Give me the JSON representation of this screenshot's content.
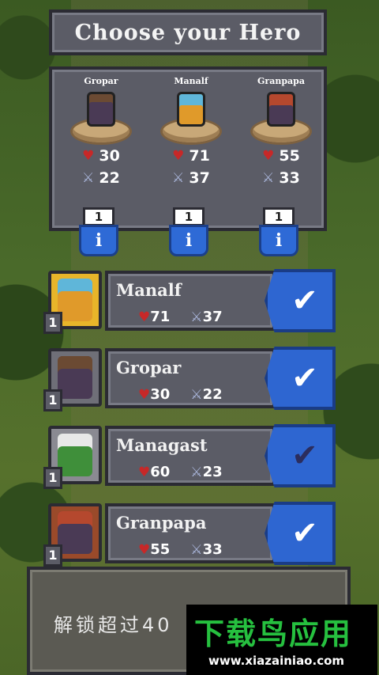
{
  "header": {
    "title": "Choose your Hero"
  },
  "selected_heroes": [
    {
      "name": "Gropar",
      "hp": "30",
      "atk": "22",
      "level": "1",
      "info_icon": "i",
      "color": "#4a3a55",
      "skin": "#6b4a33"
    },
    {
      "name": "Manalf",
      "hp": "71",
      "atk": "37",
      "level": "1",
      "info_icon": "i",
      "color": "#5fb6d9",
      "skin": "#f0c08a"
    },
    {
      "name": "Granpapa",
      "hp": "55",
      "atk": "33",
      "level": "1",
      "info_icon": "i",
      "color": "#b5482e",
      "skin": "#7a3a2a"
    }
  ],
  "hero_list": [
    {
      "name": "Manalf",
      "hp": "71",
      "atk": "37",
      "level": "1",
      "card_color": "#e8b52a",
      "sprite_color": "#5fb6d9",
      "checked": true,
      "check_color": "#ffffff"
    },
    {
      "name": "Gropar",
      "hp": "30",
      "atk": "22",
      "level": "1",
      "card_color": "#6f6f78",
      "sprite_color": "#4a3a55",
      "checked": true,
      "check_color": "#ffffff"
    },
    {
      "name": "Managast",
      "hp": "60",
      "atk": "23",
      "level": "1",
      "card_color": "#8a8a92",
      "sprite_color": "#3f8f3a",
      "checked": false,
      "check_color": "#2b2d5e"
    },
    {
      "name": "Granpapa",
      "hp": "55",
      "atk": "33",
      "level": "1",
      "card_color": "#9a4a2a",
      "sprite_color": "#b5482e",
      "checked": true,
      "check_color": "#ffffff"
    }
  ],
  "icons": {
    "heart": "♥",
    "sword": "⚔",
    "check": "✔"
  },
  "bottom_panel": {
    "text": "解锁超过40"
  },
  "watermark": {
    "brand": "下载鸟应用",
    "url": "www.xiazainiao.com"
  }
}
